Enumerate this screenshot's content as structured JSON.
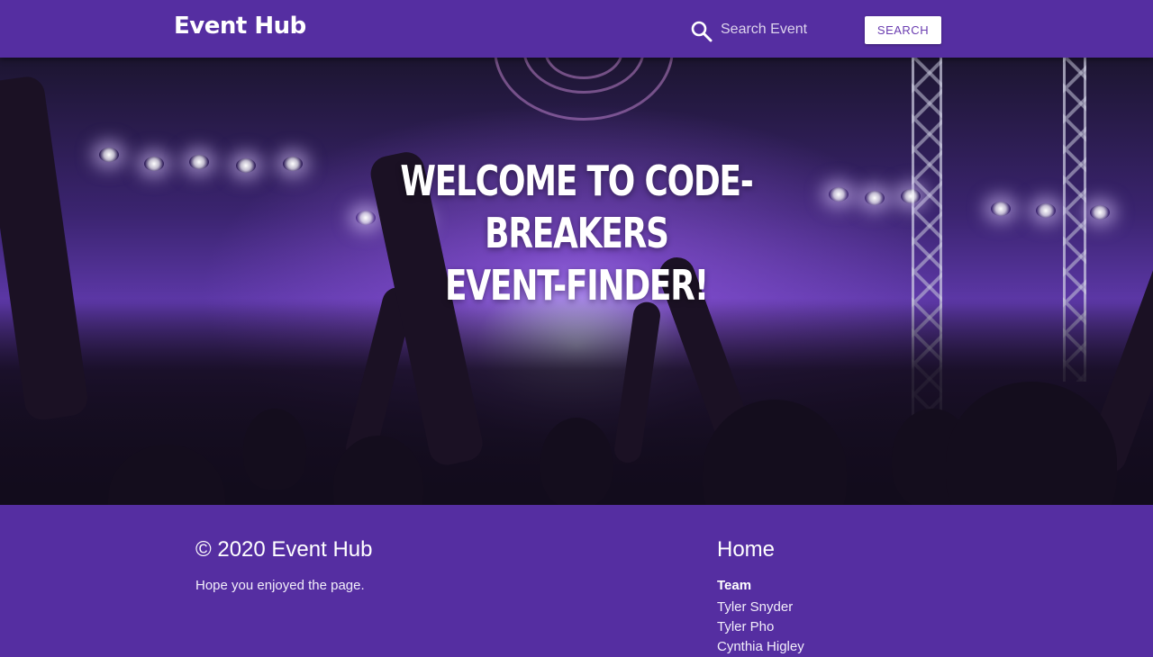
{
  "navbar": {
    "brand": "Event Hub",
    "search_placeholder": "Search Event",
    "search_button": "SEARCH"
  },
  "hero": {
    "title_line1": "WELCOME TO CODE-BREAKERS",
    "title_line2": "EVENT-FINDER!"
  },
  "footer": {
    "title": "© 2020 Event Hub",
    "text": "Hope you enjoyed the page.",
    "home_link": "Home",
    "team_heading": "Team",
    "team": [
      "Tyler Snyder",
      "Tyler Pho",
      "Cynthia Higley"
    ]
  },
  "colors": {
    "primary": "#552ea1",
    "button_text": "#6a3cb0"
  }
}
